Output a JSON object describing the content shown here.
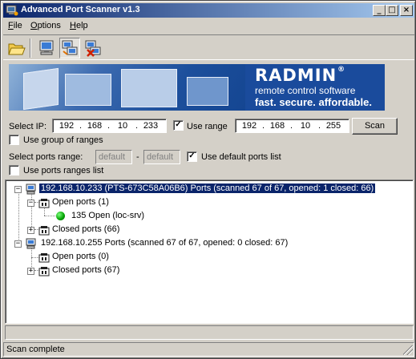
{
  "window": {
    "title": "Advanced Port Scanner v1.3",
    "minimize": "_",
    "maximize": "□",
    "close": "×"
  },
  "menu": [
    {
      "underlined": "F",
      "rest": "ile"
    },
    {
      "underlined": "O",
      "rest": "ptions"
    },
    {
      "underlined": "H",
      "rest": "elp"
    }
  ],
  "toolbar": {
    "items": [
      "open-folder-icon",
      "scan-computer-icon",
      "scan-network-icon",
      "stop-scan-icon"
    ],
    "pressed": "scan-network-icon"
  },
  "banner": {
    "brand": "RADMIN",
    "registered": "®",
    "line1": "remote control software",
    "line2": "fast. secure. affordable."
  },
  "form": {
    "select_ip_label": "Select IP:",
    "ip_from": [
      "192",
      "168",
      "10",
      "233"
    ],
    "ip_dot": ".",
    "use_range_checked": true,
    "use_range_label": "Use range",
    "ip_to": [
      "192",
      "168",
      "10",
      "255"
    ],
    "scan_button": "Scan",
    "use_group_checked": false,
    "use_group_label": "Use group of ranges",
    "select_ports_label": "Select ports range:",
    "port_from_placeholder": "default",
    "port_dash": "-",
    "port_to_placeholder": "default",
    "use_default_ports_checked": true,
    "use_default_ports_label": "Use default ports list",
    "use_ports_ranges_checked": false,
    "use_ports_ranges_label": "Use ports ranges list",
    "check_mark": "✓"
  },
  "tree": {
    "hosts": [
      {
        "label": "192.168.10.233  (PTS-673C58A06B6)     Ports (scanned 67 of 67, opened: 1 closed: 66)",
        "selected": true,
        "expanded": true,
        "open_ports": {
          "label": "Open ports (1)",
          "expanded": true,
          "children": [
            {
              "label": "135 Open (loc-srv)"
            }
          ]
        },
        "closed_ports": {
          "label": "Closed ports (66)",
          "expanded": false
        }
      },
      {
        "label": "192.168.10.255     Ports (scanned 67 of 67, opened: 0 closed: 67)",
        "selected": false,
        "expanded": true,
        "open_ports": {
          "label": "Open ports (0)",
          "expanded": false,
          "children": []
        },
        "closed_ports": {
          "label": "Closed ports (67)",
          "expanded": false
        }
      }
    ],
    "expanded_glyph": "−",
    "collapsed_glyph": "+"
  },
  "status": {
    "text": "Scan complete"
  },
  "colors": {
    "titlebar_start": "#0a246a",
    "titlebar_end": "#a6caf0",
    "banner_blue": "#1a4b9c",
    "selection": "#0a246a",
    "open_port_green": "#00a000"
  }
}
